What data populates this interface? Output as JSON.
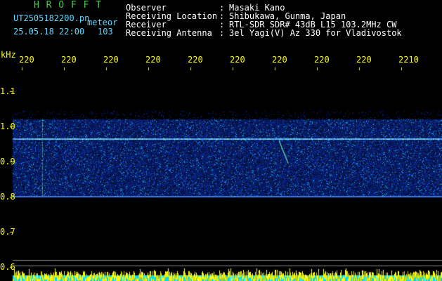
{
  "header": {
    "brand": "H R O F F T",
    "filename": "UT2505182200.pn",
    "mode": "meteor",
    "datetime": "25.05.18 22:00",
    "count": "103",
    "info": [
      {
        "label": "Observer",
        "value": "Masaki Kano"
      },
      {
        "label": "Receiving Location",
        "value": "Shibukawa, Gunma, Japan"
      },
      {
        "label": "Receiver",
        "value": "RTL-SDR SDR# 43dB L15 103.2MHz CW"
      },
      {
        "label": "Receiving Antenna",
        "value": "3el Yagi(V) Az 330 for Vladivostok"
      }
    ]
  },
  "chart_data": {
    "type": "heatmap",
    "ylabel": "kHz",
    "x_ticks": [
      "220",
      "220",
      "220",
      "220",
      "220",
      "220",
      "220",
      "220",
      "220",
      "2210"
    ],
    "y_ticks": [
      "1.1",
      "1.0",
      "0.9",
      "0.8",
      "0.7",
      "0.6"
    ],
    "ylim": [
      0.6,
      1.1
    ],
    "noise_band_khz": [
      0.8,
      1.02
    ],
    "carrier_line_khz": 0.967,
    "meteor_echo": {
      "start_khz": 0.96,
      "end_khz": 0.895
    }
  },
  "colors": {
    "background": "#000000",
    "brand": "#3cd23c",
    "filename": "#5fd6ff",
    "info": "#ffffff",
    "ticks": "#ffff00",
    "noise": "#1e3cd2",
    "signal": "#00ff80",
    "bottom_bar": "#00d8ff"
  }
}
